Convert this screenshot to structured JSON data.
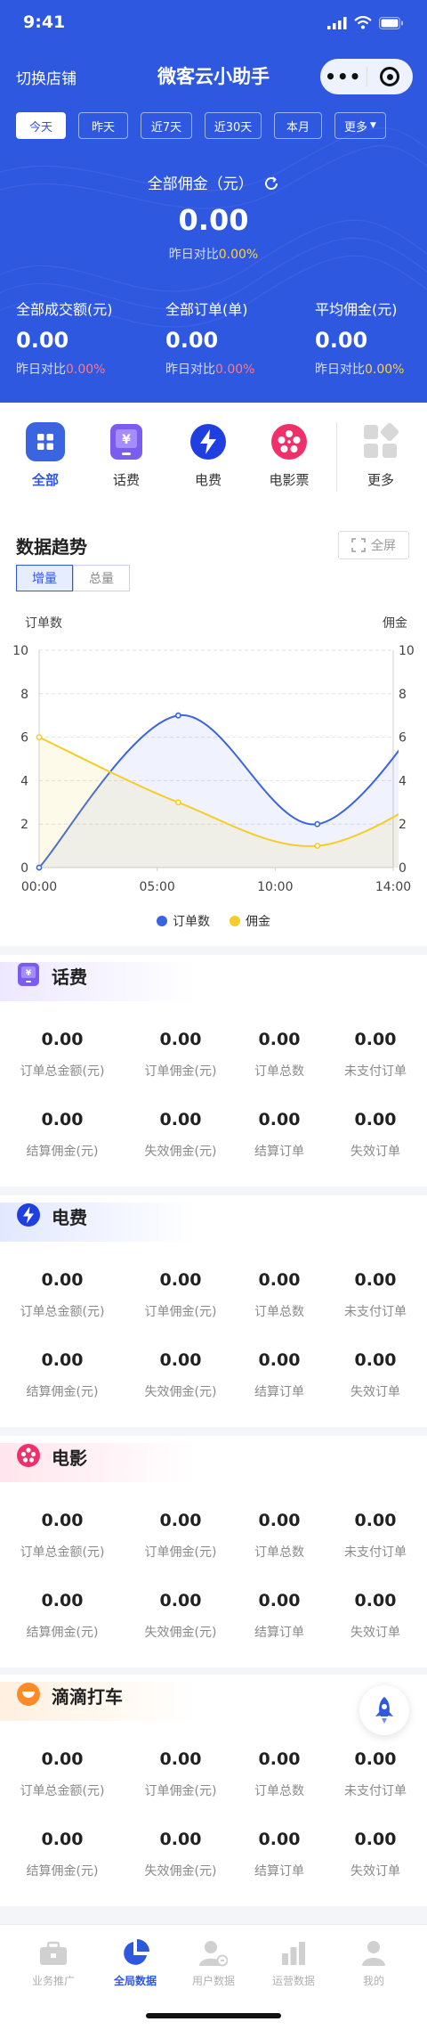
{
  "status_bar": {
    "time": "9:41"
  },
  "nav": {
    "switch_store": "切换店铺",
    "title": "微客云小助手"
  },
  "date_tabs": [
    "今天",
    "昨天",
    "近7天",
    "近30天",
    "本月",
    "更多"
  ],
  "summary": {
    "total_label": "全部佣金（元）",
    "total_value": "0.00",
    "compare_prefix": "昨日对比",
    "compare_value": "0.00%",
    "stats": [
      {
        "label": "全部成交额(元)",
        "value": "0.00",
        "compare_value": "0.00%"
      },
      {
        "label": "全部订单(单)",
        "value": "0.00",
        "compare_value": "0.00%"
      },
      {
        "label": "平均佣金(元)",
        "value": "0.00",
        "compare_value": "0.00%"
      }
    ]
  },
  "categories": [
    {
      "label": "全部",
      "icon": "grid-icon"
    },
    {
      "label": "话费",
      "icon": "phone-bill-icon"
    },
    {
      "label": "电费",
      "icon": "lightning-icon"
    },
    {
      "label": "电影票",
      "icon": "film-reel-icon"
    },
    {
      "label": "更多",
      "icon": "more-grid-icon"
    }
  ],
  "trend": {
    "title": "数据趋势",
    "fullscreen": "全屏",
    "segments": [
      "增量",
      "总量"
    ]
  },
  "chart_data": {
    "type": "line",
    "x": [
      "00:00",
      "05:00",
      "10:00",
      "14:00"
    ],
    "xlim": [
      0,
      14
    ],
    "ylabel_left": "订单数",
    "ylabel_right": "佣金",
    "ylim": [
      0,
      10
    ],
    "yticks": [
      0,
      2,
      4,
      6,
      8,
      10
    ],
    "grid": true,
    "legend_position": "bottom",
    "series": [
      {
        "name": "订单数",
        "color": "#3a64e0",
        "axis": "left",
        "points": [
          [
            0,
            0
          ],
          [
            5.5,
            7
          ],
          [
            11,
            2
          ],
          [
            16.5,
            9
          ]
        ]
      },
      {
        "name": "佣金",
        "color": "#f5cd28",
        "axis": "right",
        "points": [
          [
            0,
            6
          ],
          [
            5.5,
            3
          ],
          [
            11,
            1
          ],
          [
            16.5,
            4
          ]
        ]
      }
    ]
  },
  "sections": [
    {
      "title": "话费",
      "icon": "phone-bill-icon",
      "metrics": [
        {
          "value": "0.00",
          "label": "订单总金额(元)"
        },
        {
          "value": "0.00",
          "label": "订单佣金(元)"
        },
        {
          "value": "0.00",
          "label": "订单总数"
        },
        {
          "value": "0.00",
          "label": "未支付订单"
        },
        {
          "value": "0.00",
          "label": "结算佣金(元)"
        },
        {
          "value": "0.00",
          "label": "失效佣金(元)"
        },
        {
          "value": "0.00",
          "label": "结算订单"
        },
        {
          "value": "0.00",
          "label": "失效订单"
        }
      ]
    },
    {
      "title": "电费",
      "icon": "lightning-icon",
      "metrics": [
        {
          "value": "0.00",
          "label": "订单总金额(元)"
        },
        {
          "value": "0.00",
          "label": "订单佣金(元)"
        },
        {
          "value": "0.00",
          "label": "订单总数"
        },
        {
          "value": "0.00",
          "label": "未支付订单"
        },
        {
          "value": "0.00",
          "label": "结算佣金(元)"
        },
        {
          "value": "0.00",
          "label": "失效佣金(元)"
        },
        {
          "value": "0.00",
          "label": "结算订单"
        },
        {
          "value": "0.00",
          "label": "失效订单"
        }
      ]
    },
    {
      "title": "电影",
      "icon": "film-reel-icon",
      "metrics": [
        {
          "value": "0.00",
          "label": "订单总金额(元)"
        },
        {
          "value": "0.00",
          "label": "订单佣金(元)"
        },
        {
          "value": "0.00",
          "label": "订单总数"
        },
        {
          "value": "0.00",
          "label": "未支付订单"
        },
        {
          "value": "0.00",
          "label": "结算佣金(元)"
        },
        {
          "value": "0.00",
          "label": "失效佣金(元)"
        },
        {
          "value": "0.00",
          "label": "结算订单"
        },
        {
          "value": "0.00",
          "label": "失效订单"
        }
      ]
    },
    {
      "title": "滴滴打车",
      "icon": "didi-icon",
      "metrics": [
        {
          "value": "0.00",
          "label": "订单总金额(元)"
        },
        {
          "value": "0.00",
          "label": "订单佣金(元)"
        },
        {
          "value": "0.00",
          "label": "订单总数"
        },
        {
          "value": "0.00",
          "label": "未支付订单"
        },
        {
          "value": "0.00",
          "label": "结算佣金(元)"
        },
        {
          "value": "0.00",
          "label": "失效佣金(元)"
        },
        {
          "value": "0.00",
          "label": "结算订单"
        },
        {
          "value": "0.00",
          "label": "失效订单"
        }
      ]
    }
  ],
  "tabbar": [
    {
      "label": "业务推广",
      "icon": "briefcase-icon"
    },
    {
      "label": "全局数据",
      "icon": "pie-chart-icon"
    },
    {
      "label": "用户数据",
      "icon": "user-data-icon"
    },
    {
      "label": "运营数据",
      "icon": "bar-chart-icon"
    },
    {
      "label": "我的",
      "icon": "profile-icon"
    }
  ],
  "colors": {
    "brand": "#2f58e0",
    "accent_yellow": "#f5cd28",
    "compare_yellow": "#ffd23c",
    "compare_red": "#ff7a86"
  }
}
